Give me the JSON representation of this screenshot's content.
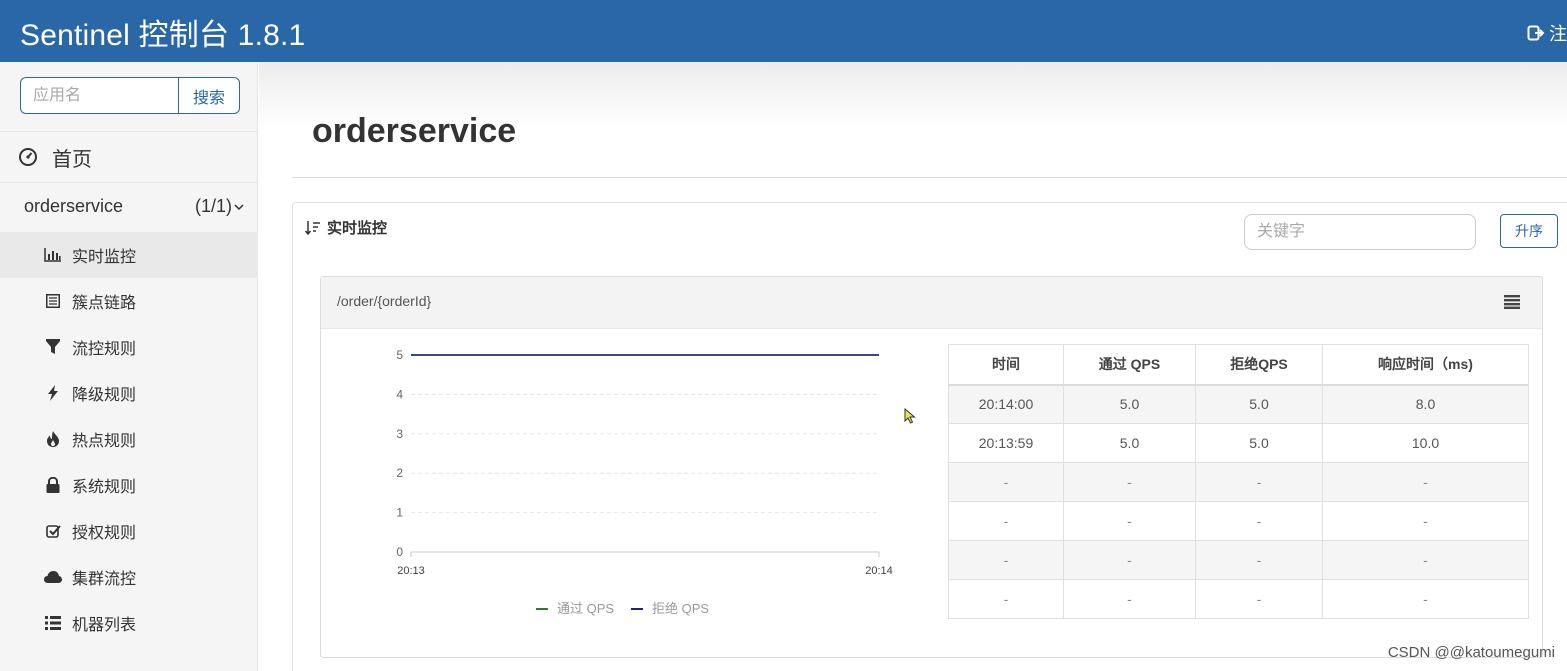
{
  "header": {
    "brand": "Sentinel 控制台 1.8.1",
    "logout_label": "注"
  },
  "sidebar": {
    "search_placeholder": "应用名",
    "search_button": "搜索",
    "home_label": "首页",
    "app_name": "orderservice",
    "app_count": "(1/1)",
    "items": [
      {
        "label": "实时监控",
        "icon": "bar-chart-icon",
        "active": true
      },
      {
        "label": "簇点链路",
        "icon": "list-icon",
        "active": false
      },
      {
        "label": "流控规则",
        "icon": "filter-icon",
        "active": false
      },
      {
        "label": "降级规则",
        "icon": "flash-icon",
        "active": false
      },
      {
        "label": "热点规则",
        "icon": "fire-icon",
        "active": false
      },
      {
        "label": "系统规则",
        "icon": "lock-icon",
        "active": false
      },
      {
        "label": "授权规则",
        "icon": "check-icon",
        "active": false
      },
      {
        "label": "集群流控",
        "icon": "cloud-icon",
        "active": false
      },
      {
        "label": "机器列表",
        "icon": "list-view-icon",
        "active": false
      }
    ]
  },
  "main": {
    "title": "orderservice",
    "panel_title": "实时监控",
    "keyword_placeholder": "关键字",
    "asc_button": "升序"
  },
  "resource": {
    "name": "/order/{orderId}",
    "table": {
      "headers": [
        "时间",
        "通过 QPS",
        "拒绝QPS",
        "响应时间（ms)"
      ],
      "rows": [
        [
          "20:14:00",
          "5.0",
          "5.0",
          "8.0"
        ],
        [
          "20:13:59",
          "5.0",
          "5.0",
          "10.0"
        ],
        [
          "-",
          "-",
          "-",
          "-"
        ],
        [
          "-",
          "-",
          "-",
          "-"
        ],
        [
          "-",
          "-",
          "-",
          "-"
        ],
        [
          "-",
          "-",
          "-",
          "-"
        ]
      ]
    }
  },
  "chart_data": {
    "type": "line",
    "x": [
      "20:13",
      "20:14"
    ],
    "series": [
      {
        "name": "通过 QPS",
        "values": [
          5,
          5
        ],
        "color": "#2e7d32"
      },
      {
        "name": "拒绝 QPS",
        "values": [
          5,
          5
        ],
        "color": "#1a237e"
      }
    ],
    "yticks": [
      0,
      1,
      2,
      3,
      4,
      5
    ],
    "ylim": [
      0,
      5
    ],
    "grid": true,
    "legend": "bottom"
  },
  "watermark": "CSDN @@katoumegumi",
  "colors": {
    "brand": "#2a67a6"
  }
}
